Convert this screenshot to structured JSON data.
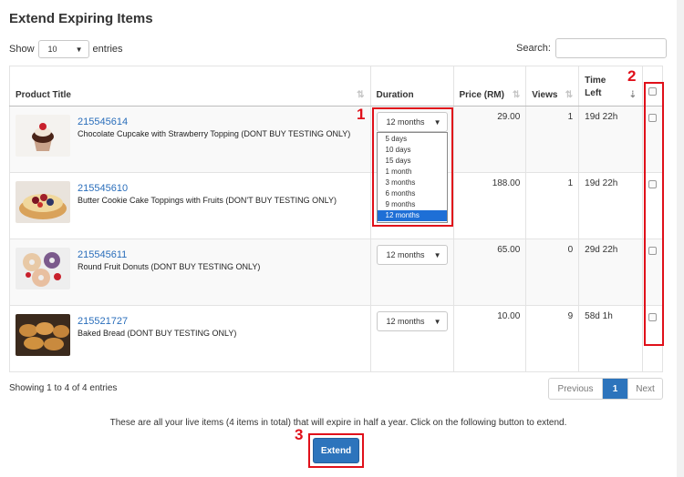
{
  "title": "Extend Expiring Items",
  "length": {
    "show": "Show",
    "value": "10",
    "entries": "entries"
  },
  "search": {
    "label": "Search:"
  },
  "columns": [
    "Product Title",
    "Duration",
    "Price (RM)",
    "Views",
    "Time Left"
  ],
  "rows": [
    {
      "id": "215545614",
      "name": "Chocolate Cupcake with Strawberry Topping (DONT BUY TESTING ONLY)",
      "duration": "12 months",
      "price": "29.00",
      "views": "1",
      "time_left": "19d 22h"
    },
    {
      "id": "215545610",
      "name": "Butter Cookie Cake Toppings with Fruits (DON'T BUY TESTING ONLY)",
      "duration": "12 months",
      "price": "188.00",
      "views": "1",
      "time_left": "19d 22h"
    },
    {
      "id": "215545611",
      "name": "Round Fruit Donuts (DONT BUY TESTING ONLY)",
      "duration": "12 months",
      "price": "65.00",
      "views": "0",
      "time_left": "29d 22h"
    },
    {
      "id": "215521727",
      "name": "Baked Bread (DONT BUY TESTING ONLY)",
      "duration": "12 months",
      "price": "10.00",
      "views": "9",
      "time_left": "58d 1h"
    }
  ],
  "duration_options": [
    "5 days",
    "10 days",
    "15 days",
    "1 month",
    "3 months",
    "6 months",
    "9 months",
    "12 months"
  ],
  "footer": {
    "info": "Showing 1 to 4 of 4 entries",
    "prev": "Previous",
    "page": "1",
    "next": "Next",
    "note": "These are all your live items (4 items in total) that will expire in half a year. Click on the following button to extend.",
    "extend": "Extend"
  },
  "annotations": [
    "1",
    "2",
    "3"
  ],
  "colors": {
    "link": "#2a6ebb",
    "primary": "#2d74bc",
    "annotation": "#e0101a"
  }
}
